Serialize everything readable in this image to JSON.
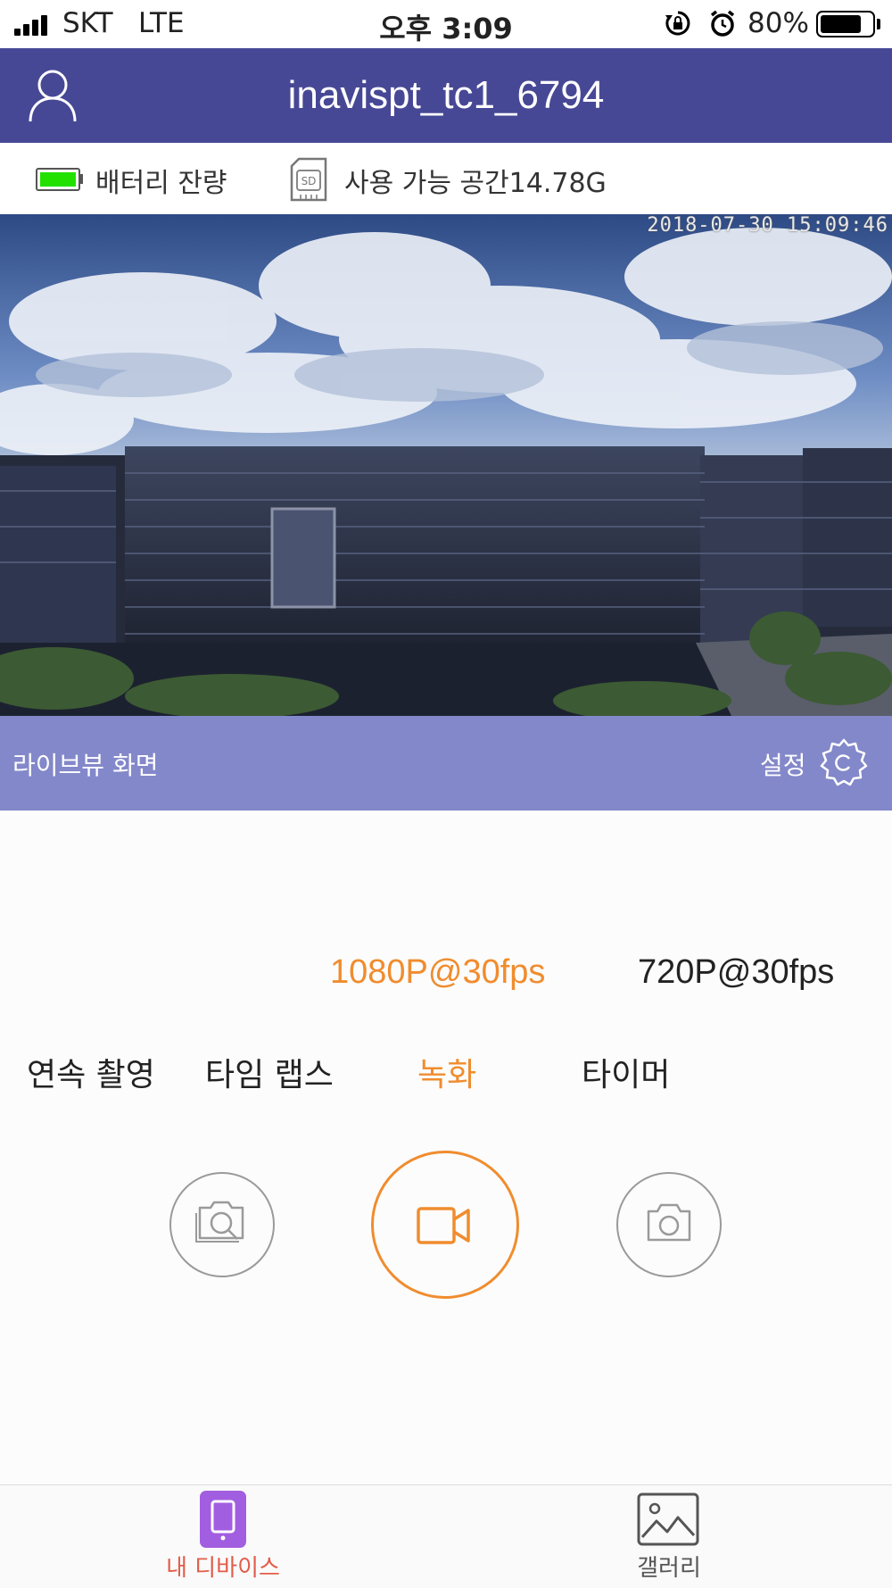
{
  "status_bar": {
    "carrier": "SKT",
    "network": "LTE",
    "time": "오후 3:09",
    "battery_percent": "80%",
    "battery_level": 0.8
  },
  "header": {
    "title": "inavispt_tc1_6794",
    "profile_icon": "user-icon"
  },
  "info": {
    "battery_label": "배터리 잔량",
    "battery_color": "#22e000",
    "storage_label": "사용 가능 공간14.78G",
    "storage_icon": "sd-card-icon"
  },
  "live_view": {
    "timestamp": "2018-07-30 15:09:46",
    "label": "라이브뷰 화면",
    "settings_label": "설정",
    "settings_icon": "gear-icon"
  },
  "resolutions": [
    {
      "label": "1080P@30fps",
      "selected": true
    },
    {
      "label": "720P@30fps",
      "selected": false
    }
  ],
  "modes": [
    {
      "label": "연속 촬영",
      "selected": false
    },
    {
      "label": "타임 랩스",
      "selected": false
    },
    {
      "label": "녹화",
      "selected": true
    },
    {
      "label": "타이머",
      "selected": false
    }
  ],
  "capture_buttons": [
    {
      "icon": "timelapse-camera-icon"
    },
    {
      "icon": "video-camera-icon",
      "active": true
    },
    {
      "icon": "camera-icon"
    }
  ],
  "tab_bar": {
    "tabs": [
      {
        "label": "내 디바이스",
        "icon": "phone-device-icon",
        "active": true
      },
      {
        "label": "갤러리",
        "icon": "gallery-icon",
        "active": false
      }
    ]
  },
  "colors": {
    "header": "#474895",
    "live_bar": "#8388ca",
    "accent": "#f08c2e",
    "tab_active": "#e25c49"
  }
}
